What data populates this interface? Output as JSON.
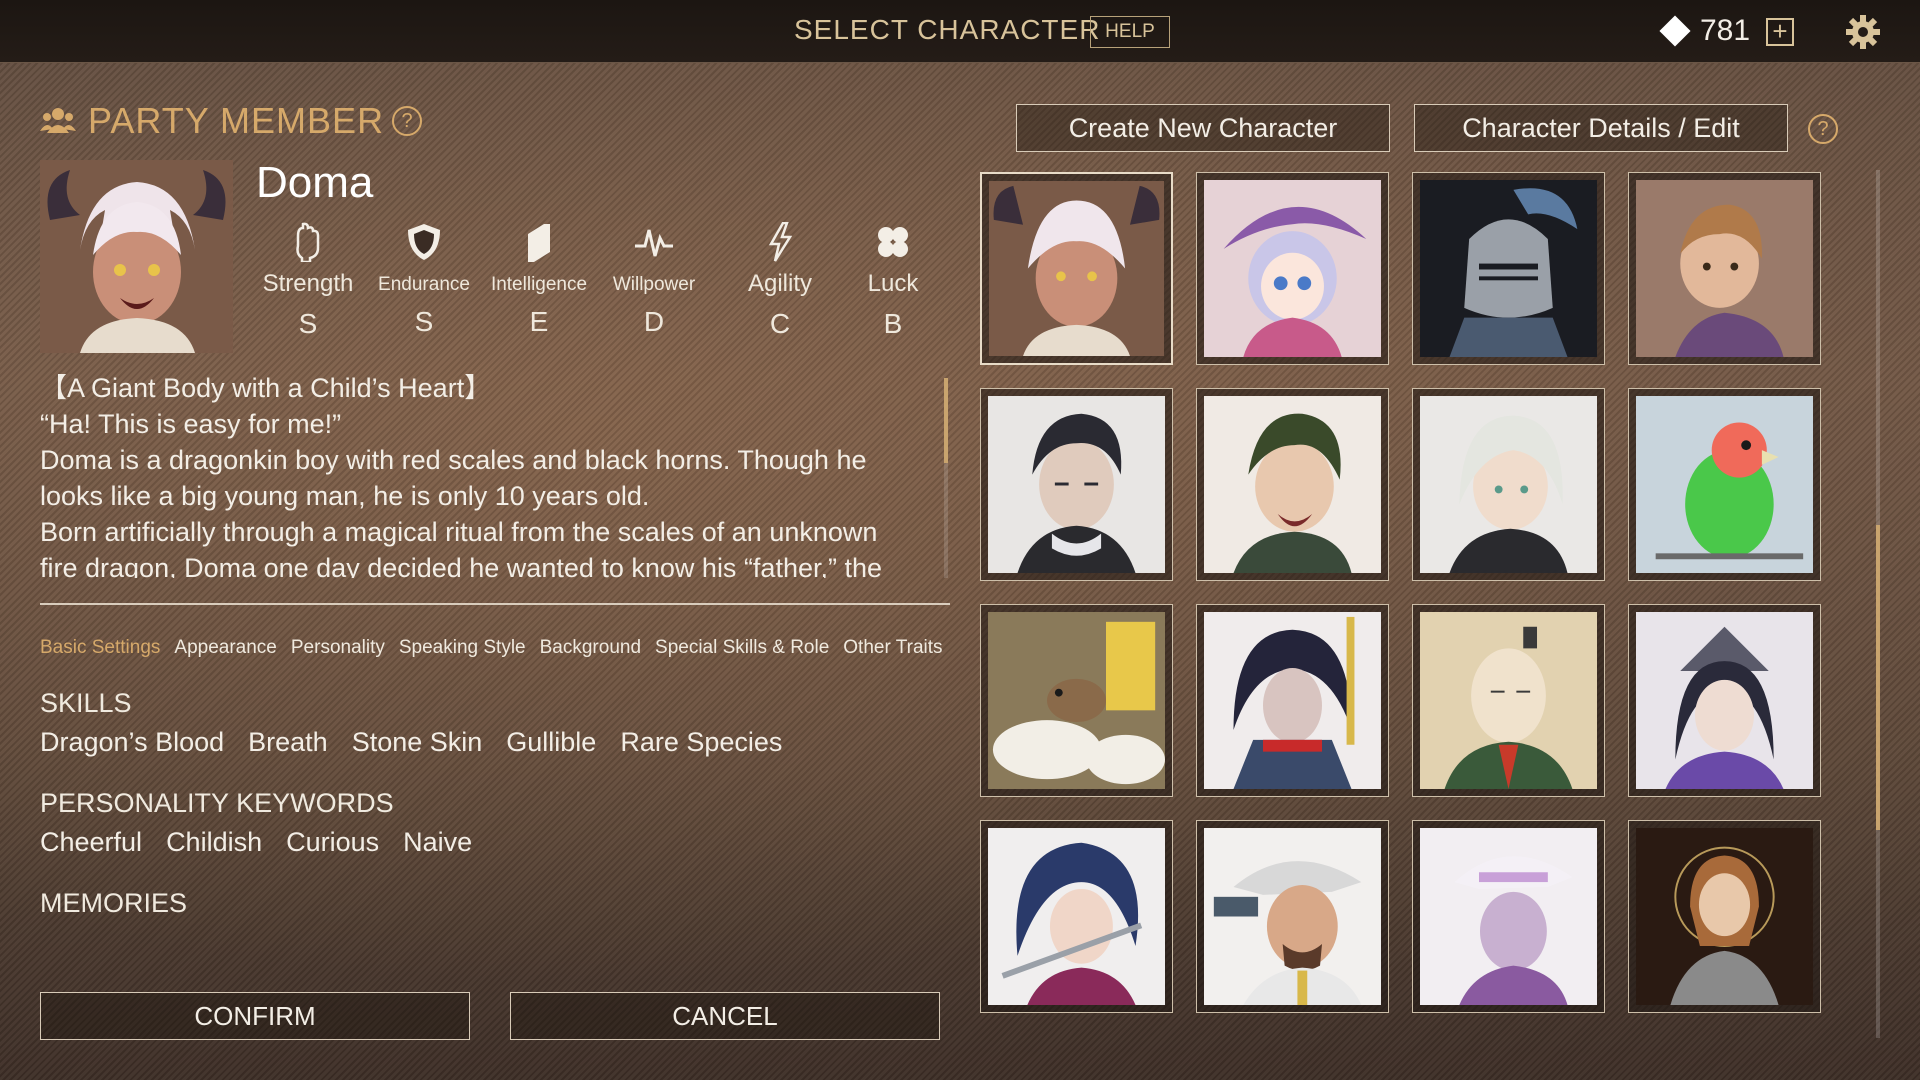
{
  "header": {
    "title": "SELECT CHARACTER",
    "help_label": "HELP",
    "currency": "781"
  },
  "party": {
    "heading": "PARTY MEMBER",
    "question": "?"
  },
  "character": {
    "name": "Doma",
    "stats": [
      {
        "label": "Strength",
        "grade": "S",
        "icon": "fist-icon"
      },
      {
        "label": "Endurance",
        "grade": "S",
        "icon": "shield-icon"
      },
      {
        "label": "Intelligence",
        "grade": "E",
        "icon": "book-icon"
      },
      {
        "label": "Willpower",
        "grade": "D",
        "icon": "pulse-icon"
      },
      {
        "label": "Agility",
        "grade": "C",
        "icon": "lightning-icon"
      },
      {
        "label": "Luck",
        "grade": "B",
        "icon": "clover-icon"
      }
    ],
    "description": [
      "【A Giant Body with a Child’s Heart】",
      "“Ha! This is easy for me!”",
      "Doma is a dragonkin boy with red scales and black horns. Though he",
      "looks like a big young man, he is only 10 years old.",
      "Born artificially through a magical ritual from the scales of an unknown",
      "fire dragon, Doma one day decided he wanted to know his “father,” the"
    ]
  },
  "tabs": [
    "Basic Settings",
    "Appearance",
    "Personality",
    "Speaking Style",
    "Background",
    "Special Skills & Role",
    "Other Traits"
  ],
  "skills": {
    "title": "SKILLS",
    "items": [
      "Dragon’s Blood",
      "Breath",
      "Stone Skin",
      "Gullible",
      "Rare Species"
    ]
  },
  "personality": {
    "title": "PERSONALITY KEYWORDS",
    "items": [
      "Cheerful",
      "Childish",
      "Curious",
      "Naive"
    ]
  },
  "memories": {
    "title": "MEMORIES"
  },
  "buttons": {
    "confirm": "CONFIRM",
    "cancel": "CANCEL",
    "create": "Create New Character",
    "details": "Character Details / Edit"
  },
  "roster": [
    "dragonkin-boy",
    "witch-girl",
    "armored-knight",
    "archer-youth",
    "dark-haired-man",
    "green-haired-man",
    "white-haired-youth",
    "lovebird",
    "mouse",
    "masked-warrior",
    "samurai-lord",
    "shrine-maiden",
    "swordswoman",
    "gunslinger",
    "hat-figure",
    "saint-portrait"
  ],
  "colors": {
    "accent": "#d6a96a",
    "header_bg": "#1c1612"
  }
}
